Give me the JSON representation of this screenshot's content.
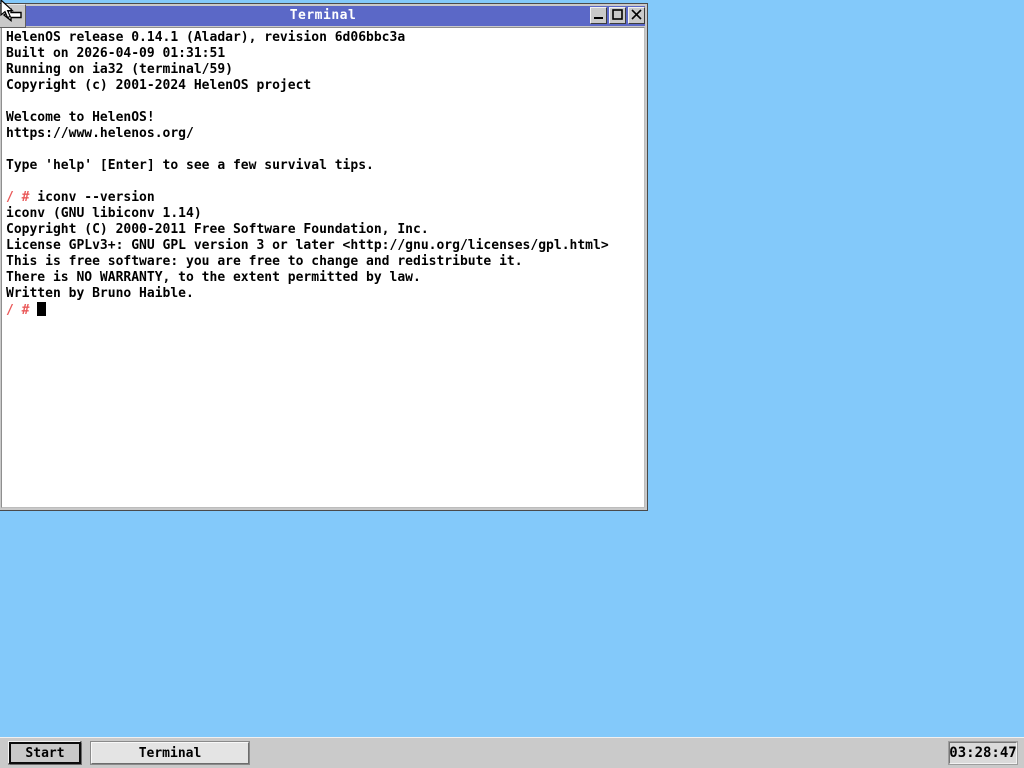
{
  "colors": {
    "desktop": "#83c9fa",
    "titlebar": "#5b68c7",
    "title_text": "#ffffff",
    "terminal_bg": "#ffffff",
    "terminal_text": "#000000",
    "prompt": "#ea5a5a",
    "taskbar": "#cacaca"
  },
  "window": {
    "title": "Terminal",
    "control_icons": [
      "minimize-icon",
      "maximize-icon",
      "close-icon"
    ],
    "sysmenu_icon": "back-arrow-icon"
  },
  "terminal": {
    "lines": [
      [
        {
          "t": "HelenOS release 0.14.1 (Aladar), revision 6d06bbc3a"
        }
      ],
      [
        {
          "t": "Built on 2026-04-09 01:31:51"
        }
      ],
      [
        {
          "t": "Running on ia32 (terminal/59)"
        }
      ],
      [
        {
          "t": "Copyright (c) 2001-2024 HelenOS project"
        }
      ],
      [],
      [
        {
          "t": "Welcome to HelenOS!"
        }
      ],
      [
        {
          "t": "https://www.helenos.org/"
        }
      ],
      [],
      [
        {
          "t": "Type 'help' [Enter] to see a few survival tips."
        }
      ],
      [],
      [
        {
          "t": "/ #",
          "c": "prompt"
        },
        {
          "t": " iconv --version"
        }
      ],
      [
        {
          "t": "iconv (GNU libiconv 1.14)"
        }
      ],
      [
        {
          "t": "Copyright (C) 2000-2011 Free Software Foundation, Inc."
        }
      ],
      [
        {
          "t": "License GPLv3+: GNU GPL version 3 or later <http://gnu.org/licenses/gpl.html>"
        }
      ],
      [
        {
          "t": "This is free software: you are free to change and redistribute it."
        }
      ],
      [
        {
          "t": "There is NO WARRANTY, to the extent permitted by law."
        }
      ],
      [
        {
          "t": "Written by Bruno Haible."
        }
      ],
      [
        {
          "t": "/ #",
          "c": "prompt"
        },
        {
          "t": " "
        },
        {
          "cursor": true
        }
      ]
    ]
  },
  "taskbar": {
    "start_label": "Start",
    "window_button_label": "Terminal",
    "clock": "03:28:47"
  }
}
